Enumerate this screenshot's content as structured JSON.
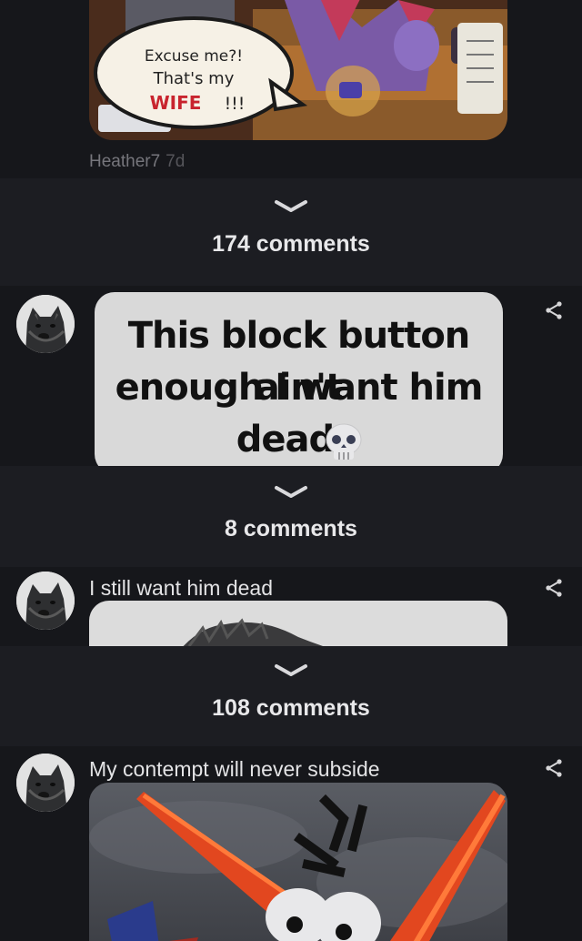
{
  "feed": {
    "post1": {
      "comic_text": [
        "Excuse me?!",
        "That's my",
        "WIFE",
        "!!!"
      ],
      "author": "Heather7",
      "age": "7d"
    },
    "gap1": {
      "comments": "174 comments"
    },
    "post2": {
      "caption": [
        "This block button ain't",
        "enough I want him",
        "dead"
      ]
    },
    "gap2": {
      "comments": "8 comments"
    },
    "post3": {
      "text": "I still want him dead"
    },
    "gap3": {
      "comments": "108 comments"
    },
    "post4": {
      "text": "My contempt will never subside"
    }
  },
  "icons": {
    "share": "share-icon",
    "chevron": "chevron-down-icon",
    "skull": "skull-icon"
  }
}
